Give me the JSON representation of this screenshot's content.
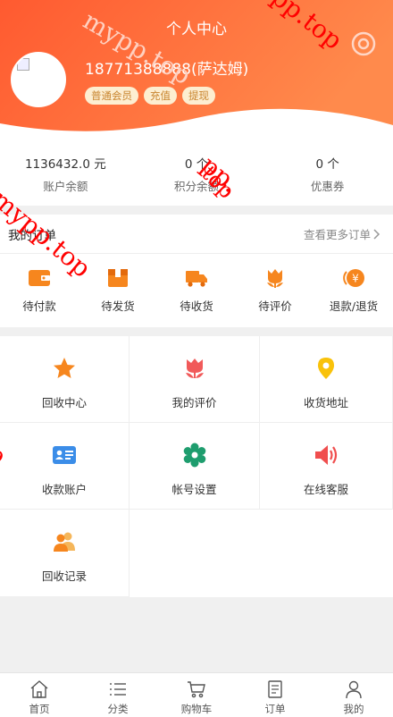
{
  "header": {
    "title": "个人中心",
    "user_name": "18771388888(萨达姆)",
    "tags": [
      "普通会员",
      "充值",
      "提现"
    ],
    "gradient": [
      "#ff5a30",
      "#ff8a4c"
    ]
  },
  "stats": [
    {
      "value": "1136432.0 元",
      "label": "账户余额"
    },
    {
      "value": "0 个",
      "label": "积分余额"
    },
    {
      "value": "0 个",
      "label": "优惠券"
    }
  ],
  "orders": {
    "title": "我的订单",
    "more": "查看更多订单",
    "items": [
      {
        "label": "待付款",
        "icon": "wallet-icon"
      },
      {
        "label": "待发货",
        "icon": "box-icon"
      },
      {
        "label": "待收货",
        "icon": "truck-icon"
      },
      {
        "label": "待评价",
        "icon": "flower-icon"
      },
      {
        "label": "退款/退货",
        "icon": "refund-icon",
        "glyph": "¥"
      }
    ]
  },
  "grid": [
    {
      "label": "回收中心",
      "icon": "star-icon"
    },
    {
      "label": "我的评价",
      "icon": "tulip-icon"
    },
    {
      "label": "收货地址",
      "icon": "location-pin-icon"
    },
    {
      "label": "收款账户",
      "icon": "id-card-icon"
    },
    {
      "label": "帐号设置",
      "icon": "gear-icon"
    },
    {
      "label": "在线客服",
      "icon": "speaker-icon"
    },
    {
      "label": "回收记录",
      "icon": "users-icon"
    }
  ],
  "tabbar": [
    {
      "label": "首页",
      "icon": "home-icon"
    },
    {
      "label": "分类",
      "icon": "list-icon"
    },
    {
      "label": "购物车",
      "icon": "cart-icon"
    },
    {
      "label": "订单",
      "icon": "order-doc-icon"
    },
    {
      "label": "我的",
      "icon": "user-icon"
    }
  ],
  "watermarks": [
    "pp.top",
    "mypp.top",
    "pp.",
    "mypp.top",
    "top",
    "p"
  ]
}
